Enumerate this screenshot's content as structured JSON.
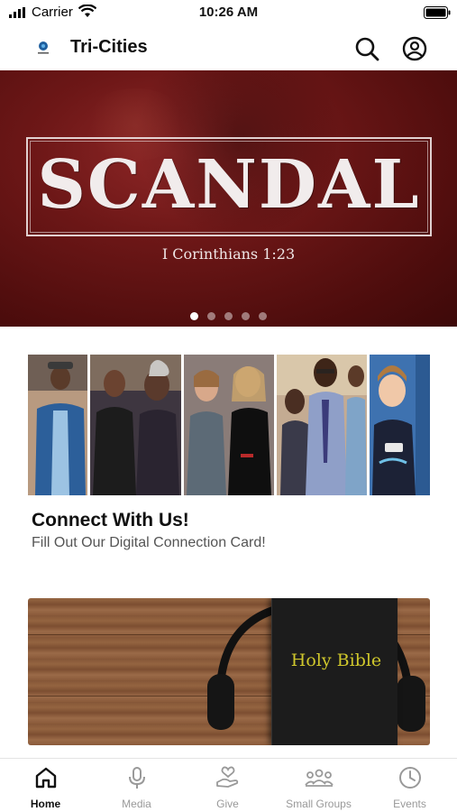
{
  "status_bar": {
    "carrier": "Carrier",
    "time": "10:26 AM"
  },
  "header": {
    "title": "Tri-Cities"
  },
  "hero": {
    "title": "SCANDAL",
    "reference": "I Corinthians 1:23",
    "dots_total": 5,
    "active_dot": 0
  },
  "connect_card": {
    "title": "Connect With Us!",
    "subtitle": "Fill Out Our Digital Connection Card!"
  },
  "bible_card": {
    "book_text": "Holy Bible"
  },
  "tabs": [
    {
      "label": "Home",
      "icon": "home-icon",
      "active": true
    },
    {
      "label": "Media",
      "icon": "microphone-icon",
      "active": false
    },
    {
      "label": "Give",
      "icon": "give-icon",
      "active": false
    },
    {
      "label": "Small Groups",
      "icon": "groups-icon",
      "active": false
    },
    {
      "label": "Events",
      "icon": "clock-icon",
      "active": false
    }
  ],
  "colors": {
    "hero_red": "#6d1717",
    "bible_gold": "#cfc72c",
    "tab_active": "#111111",
    "tab_inactive": "#999999"
  }
}
